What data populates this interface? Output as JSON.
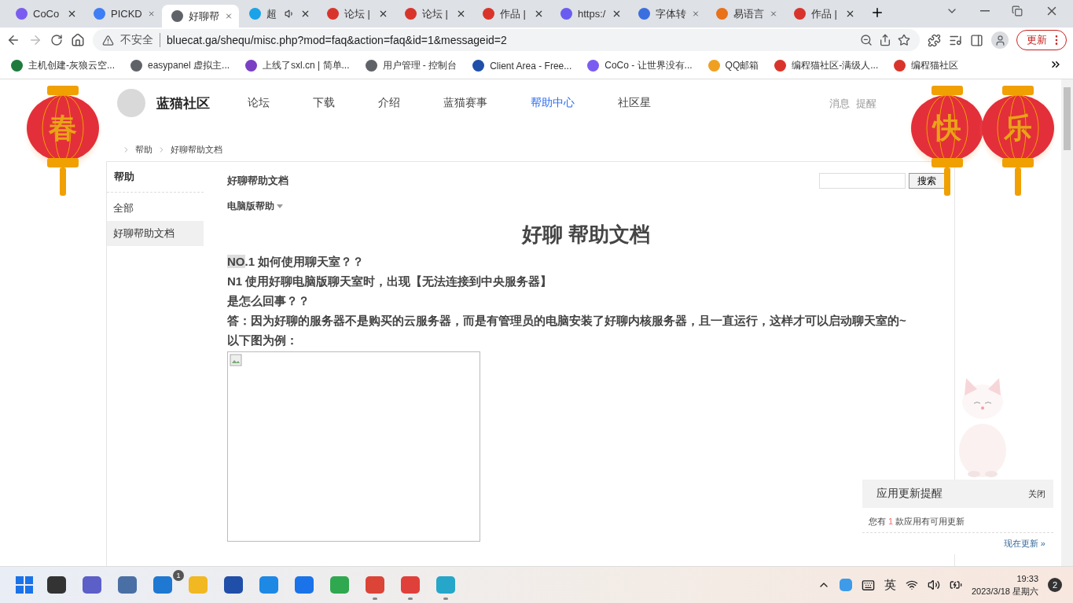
{
  "browser": {
    "tabs": [
      {
        "title": "CoCo",
        "color": "#7b5cf0",
        "selected": false,
        "audio": false
      },
      {
        "title": "PICKD",
        "color": "#3f7ef5",
        "selected": false,
        "audio": false
      },
      {
        "title": "好聊帮",
        "color": "#5f6368",
        "selected": true,
        "audio": false
      },
      {
        "title": "超",
        "color": "#1aa3e8",
        "selected": false,
        "audio": true
      },
      {
        "title": "论坛 |",
        "color": "#d9342b",
        "selected": false,
        "audio": false
      },
      {
        "title": "论坛 |",
        "color": "#d9342b",
        "selected": false,
        "audio": false
      },
      {
        "title": "作品 |",
        "color": "#d9342b",
        "selected": false,
        "audio": false
      },
      {
        "title": "https:/",
        "color": "#6a5cf0",
        "selected": false,
        "audio": false
      },
      {
        "title": "字体转",
        "color": "#3b6fe0",
        "selected": false,
        "audio": false
      },
      {
        "title": "易语言",
        "color": "#e8711a",
        "selected": false,
        "audio": false
      },
      {
        "title": "作品 |",
        "color": "#d9342b",
        "selected": false,
        "audio": false
      }
    ],
    "security": "不安全",
    "address": "bluecat.ga/shequ/misc.php?mod=faq&action=faq&id=1&messageid=2",
    "update_button": "更新",
    "bookmarks": [
      {
        "label": "主机创建-灰狼云空...",
        "color": "#1e7b3c"
      },
      {
        "label": "easypanel 虚拟主...",
        "color": "#5f6368"
      },
      {
        "label": "上线了sxl.cn | 简单...",
        "color": "#7b3fc4"
      },
      {
        "label": "用户管理 - 控制台",
        "color": "#5f6368"
      },
      {
        "label": "Client Area - Free...",
        "color": "#1f4fa8"
      },
      {
        "label": "CoCo - 让世界没有...",
        "color": "#7b5cf0"
      },
      {
        "label": "QQ邮箱",
        "color": "#f0a020"
      },
      {
        "label": "编程猫社区-满级人...",
        "color": "#d9342b"
      },
      {
        "label": "编程猫社区",
        "color": "#d9342b"
      }
    ]
  },
  "site": {
    "logo": "蓝猫社区",
    "nav": [
      {
        "label": "论坛",
        "selected": false
      },
      {
        "label": "下载",
        "selected": false
      },
      {
        "label": "介绍",
        "selected": false
      },
      {
        "label": "蓝猫赛事",
        "selected": false
      },
      {
        "label": "帮助中心",
        "selected": true
      },
      {
        "label": "社区星",
        "selected": false
      }
    ],
    "user_links": [
      "消息",
      "提醒"
    ],
    "breadcrumb": [
      "帮助",
      "好聊帮助文档"
    ]
  },
  "lanterns": [
    {
      "char": "春"
    },
    {
      "char": "快"
    },
    {
      "char": "乐"
    }
  ],
  "sidebar": {
    "title": "帮助",
    "items": [
      {
        "label": "全部",
        "selected": false
      },
      {
        "label": "好聊帮助文档",
        "selected": true
      }
    ]
  },
  "article": {
    "heading": "好聊帮助文档",
    "search_button": "搜索",
    "category": "电脑版帮助",
    "title": "好聊 帮助文档",
    "paragraphs": [
      {
        "highlight": "NO",
        "text": ".1 如何使用聊天室？？"
      },
      {
        "text": "N1 使用好聊电脑版聊天室时，出现【无法连接到中央服务器】"
      },
      {
        "text": "是怎么回事？？"
      },
      {
        "text": "答：因为好聊的服务器不是购买的云服务器，而是有管理员的电脑安装了好聊内核服务器，且一直运行，这样才可以启动聊天室的~"
      },
      {
        "text": "以下图为例："
      }
    ]
  },
  "notice": {
    "title": "应用更新提醒",
    "close": "关闭",
    "before": "您有",
    "count": "1",
    "after": "款应用有可用更新",
    "link": "现在更新 »"
  },
  "taskbar": {
    "apps": [
      {
        "color": "#333333",
        "running": false
      },
      {
        "color": "#5b5fc7",
        "running": false
      },
      {
        "color": "#4a6fa5",
        "running": false
      },
      {
        "color": "#1f78d1",
        "running": false,
        "badge": "1"
      },
      {
        "color": "#f2b821",
        "running": false
      },
      {
        "color": "#1f4fa8",
        "running": false
      },
      {
        "color": "#1e88e5",
        "running": false
      },
      {
        "color": "#1a73e8",
        "running": false
      },
      {
        "color": "#2fa84f",
        "running": false
      },
      {
        "color": "#db4437",
        "running": true
      },
      {
        "color": "#e0403a",
        "running": true
      },
      {
        "color": "#26a6c9",
        "running": true
      }
    ],
    "ime": "英",
    "time": "19:33",
    "date": "2023/3/18 星期六",
    "notifications": "2"
  }
}
